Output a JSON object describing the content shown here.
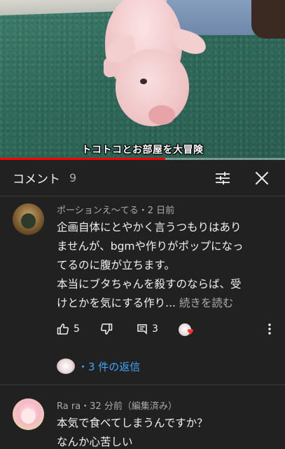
{
  "video": {
    "caption": "トコトコとお部屋を大冒険",
    "progress": 0.58
  },
  "comments_header": {
    "title": "コメント",
    "count": "9"
  },
  "comments": [
    {
      "author_meta": "ポーションえ〜てる・2 日前",
      "lines": [
        "企画自体にとやかく言うつもりはあり",
        "ませんが、bgmや作りがポップになっ",
        "てるのに腹が立ちます。",
        "本当にブタちゃんを殺すのならば、受",
        "けとかを気にする作り..."
      ],
      "read_more": "続きを読む",
      "likes": "5",
      "replies_count": "3",
      "replies_link": "・3 件の返信"
    },
    {
      "author_meta": "Ra ra・32 分前（編集済み）",
      "lines": [
        "本気で食べてしまうんですか？",
        "なんか心苦しい"
      ]
    }
  ],
  "colors": {
    "background": "#212121",
    "text_primary": "#f1f1f1",
    "text_secondary": "#aaaaaa",
    "link": "#3ea6ff",
    "progress": "#ff0000",
    "heart": "#ff2d2d"
  }
}
